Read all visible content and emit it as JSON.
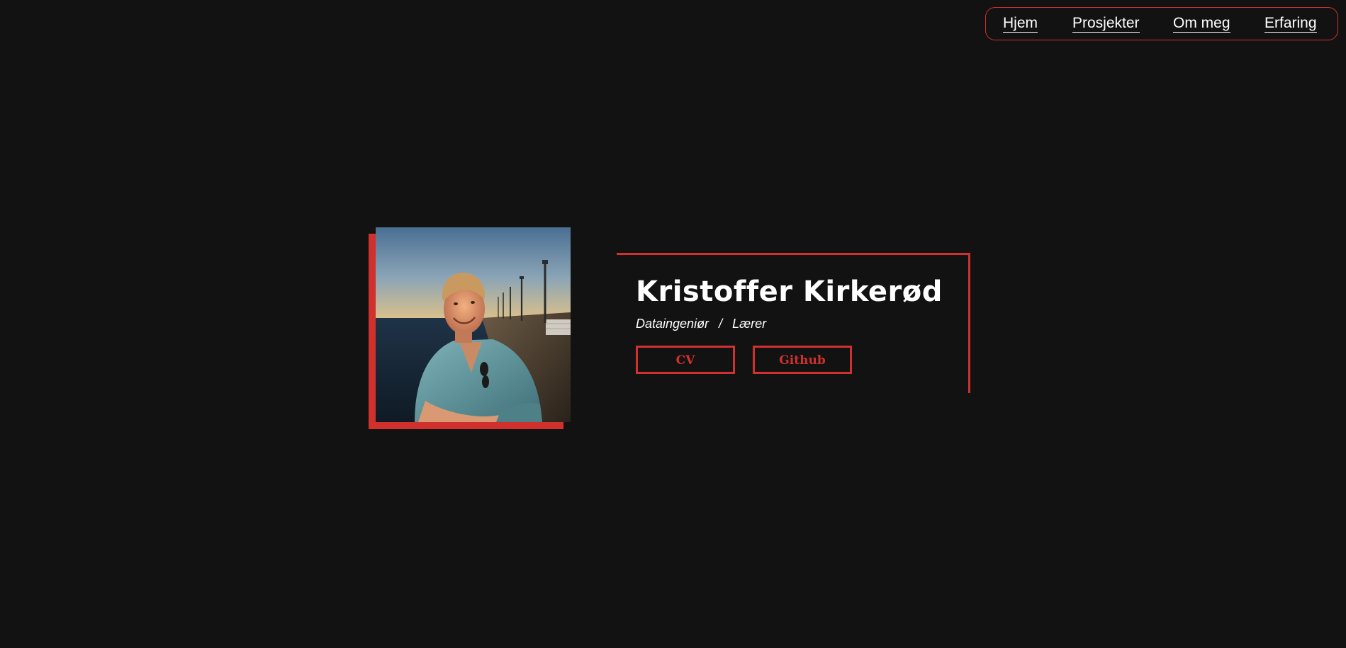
{
  "nav": {
    "items": [
      {
        "label": "Hjem"
      },
      {
        "label": "Prosjekter"
      },
      {
        "label": "Om meg"
      },
      {
        "label": "Erfaring"
      }
    ]
  },
  "hero": {
    "name": "Kristoffer Kirkerød",
    "roles": [
      "Dataingeniør",
      "Lærer"
    ],
    "separator": "/",
    "buttons": {
      "cv": "CV",
      "github": "Github"
    }
  },
  "colors": {
    "background": "#121212",
    "accent": "#d0312d",
    "text": "#ffffff"
  }
}
